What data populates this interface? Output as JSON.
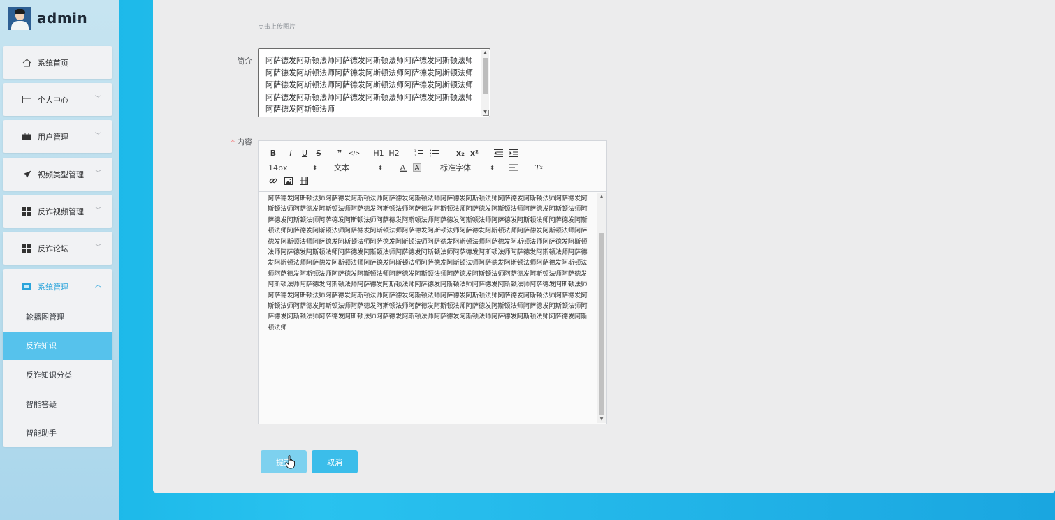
{
  "app": {
    "user": "admin"
  },
  "sidebar": {
    "items": [
      {
        "label": "系统首页",
        "icon": "home-icon"
      },
      {
        "label": "个人中心",
        "icon": "id-card-icon"
      },
      {
        "label": "用户管理",
        "icon": "briefcase-icon"
      },
      {
        "label": "视频类型管理",
        "icon": "paper-plane-icon"
      },
      {
        "label": "反诈视频管理",
        "icon": "grid-icon"
      },
      {
        "label": "反诈论坛",
        "icon": "grid-icon"
      },
      {
        "label": "系统管理",
        "icon": "system-icon",
        "expanded": true
      }
    ],
    "submenu": [
      {
        "label": "轮播图管理"
      },
      {
        "label": "反诈知识",
        "active": true
      },
      {
        "label": "反诈知识分类"
      },
      {
        "label": "智能答疑"
      },
      {
        "label": "智能助手"
      }
    ]
  },
  "form": {
    "upload_hint": "点击上传图片",
    "summary_label": "简介",
    "summary_value": "阿萨德发阿斯顿法师阿萨德发阿斯顿法师阿萨德发阿斯顿法师阿萨德发阿斯顿法师阿萨德发阿斯顿法师阿萨德发阿斯顿法师阿萨德发阿斯顿法师阿萨德发阿斯顿法师阿萨德发阿斯顿法师阿萨德发阿斯顿法师阿萨德发阿斯顿法师阿萨德发阿斯顿法师阿萨德发阿斯顿法师",
    "content_label": "内容",
    "content_required_mark": "*",
    "editor": {
      "font_size": "14px",
      "block_type": "文本",
      "font_family": "标准字体",
      "buttons": [
        "B",
        "I",
        "U",
        "S",
        "❞",
        "</>",
        "H1",
        "H2",
        "x₂",
        "x²"
      ],
      "content": "阿萨德发阿斯顿法师阿萨德发阿斯顿法师阿萨德发阿斯顿法师阿萨德发阿斯顿法师阿萨德发阿斯顿法师阿萨德发阿斯顿法师阿萨德发阿斯顿法师阿萨德发阿斯顿法师阿萨德发阿斯顿法师阿萨德发阿斯顿法师阿萨德发阿斯顿法师阿萨德发阿斯顿法师阿萨德发阿斯顿法师阿萨德发阿斯顿法师阿萨德发阿斯顿法师阿萨德发阿斯顿法师阿萨德发阿斯顿法师阿萨德发阿斯顿法师阿萨德发阿斯顿法师阿萨德发阿斯顿法师阿萨德发阿斯顿法师阿萨德发阿斯顿法师阿萨德发阿斯顿法师阿萨德发阿斯顿法师阿萨德发阿斯顿法师阿萨德发阿斯顿法师阿萨德发阿斯顿法师阿萨德发阿斯顿法师阿萨德发阿斯顿法师阿萨德发阿斯顿法师阿萨德发阿斯顿法师阿萨德发阿斯顿法师阿萨德发阿斯顿法师阿萨德发阿斯顿法师阿萨德发阿斯顿法师阿萨德发阿斯顿法师阿萨德发阿斯顿法师阿萨德发阿斯顿法师阿萨德发阿斯顿法师阿萨德发阿斯顿法师阿萨德发阿斯顿法师阿萨德发阿斯顿法师阿萨德发阿斯顿法师阿萨德发阿斯顿法师阿萨德发阿斯顿法师阿萨德发阿斯顿法师阿萨德发阿斯顿法师阿萨德发阿斯顿法师阿萨德发阿斯顿法师阿萨德发阿斯顿法师阿萨德发阿斯顿法师阿萨德发阿斯顿法师阿萨德发阿斯顿法师阿萨德发阿斯顿法师阿萨德发阿斯顿法师阿萨德发阿斯顿法师阿萨德发阿斯顿法师阿萨德发阿斯顿法师阿萨德发阿斯顿法师阿萨德发阿斯顿法师阿萨德发阿斯顿法师阿萨德发阿斯顿法师阿萨德发阿斯顿法师阿萨德发阿斯顿法师阿萨德发阿斯顿法师阿萨德发阿斯顿法师阿萨德发阿斯顿法师"
    },
    "submit_label": "提交",
    "cancel_label": "取消"
  },
  "colors": {
    "accent": "#2aa4db",
    "active_item_bg": "#56c2ec",
    "button_bg": "#3bbdea",
    "required": "#f56c6c"
  }
}
